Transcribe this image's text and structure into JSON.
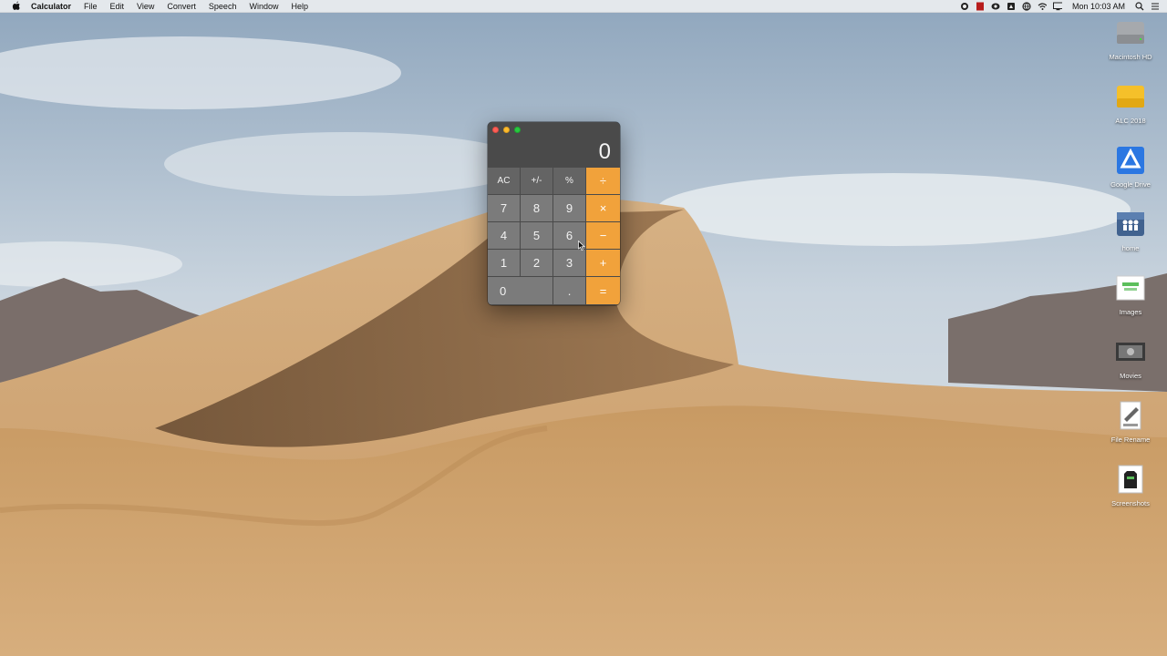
{
  "menubar": {
    "apple_icon": "apple-icon",
    "app_name": "Calculator",
    "items": [
      "File",
      "Edit",
      "View",
      "Convert",
      "Speech",
      "Window",
      "Help"
    ],
    "clock": "Mon 10:03 AM",
    "status_icons": [
      "record-icon",
      "red-app-icon",
      "creative-cloud-icon",
      "drive-icon",
      "globe-icon",
      "wifi-icon",
      "display-icon"
    ]
  },
  "desktop": {
    "icons": [
      {
        "label": "Macintosh HD",
        "icon": "hard-drive-icon"
      },
      {
        "label": "ALC 2018",
        "icon": "yellow-drive-icon"
      },
      {
        "label": "Google Drive",
        "icon": "google-drive-icon"
      },
      {
        "label": "home",
        "icon": "home-share-icon"
      },
      {
        "label": "Images",
        "icon": "images-folder-icon"
      },
      {
        "label": "Movies",
        "icon": "movies-folder-icon"
      },
      {
        "label": "File Rename",
        "icon": "file-rename-icon"
      },
      {
        "label": "Screenshots",
        "icon": "screenshots-folder-icon"
      }
    ]
  },
  "calculator": {
    "display": "0",
    "colors": {
      "operator": "#f1a23b",
      "function": "#646464",
      "number": "#7b7b7b"
    },
    "keys": {
      "ac": "AC",
      "sign": "+/-",
      "percent": "%",
      "divide": "÷",
      "seven": "7",
      "eight": "8",
      "nine": "9",
      "multiply": "×",
      "four": "4",
      "five": "5",
      "six": "6",
      "minus": "−",
      "one": "1",
      "two": "2",
      "three": "3",
      "plus": "+",
      "zero": "0",
      "decimal": ".",
      "equals": "="
    }
  }
}
